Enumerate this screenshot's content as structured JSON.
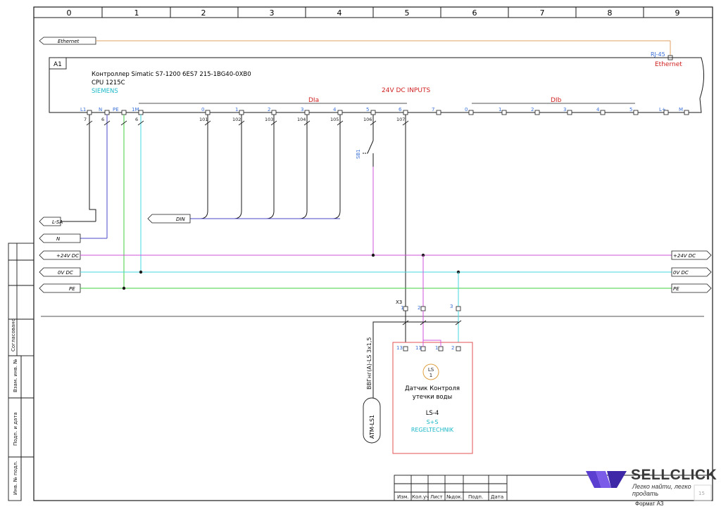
{
  "ruler": [
    "0",
    "1",
    "2",
    "3",
    "4",
    "5",
    "6",
    "7",
    "8",
    "9"
  ],
  "module": {
    "tag": "A1",
    "line1": "Контроллер  Simatic S7-1200  6ES7 215-1BG40-0XB0",
    "line2": "CPU 1215C",
    "vendor": "SIEMENS",
    "inputs_title": "24V DC INPUTS",
    "group_a": "DIa",
    "group_b": "DIb",
    "rj45": "RJ-45",
    "ethernet_port": "Ethernet"
  },
  "pins_top": [
    "L1",
    "N",
    "PE",
    "1M",
    "0",
    "1",
    "2",
    "3",
    "4",
    "5",
    "6",
    "7",
    "0",
    "1",
    "2",
    "3",
    "4",
    "5",
    "L+",
    "M"
  ],
  "wire_numbers": [
    "7",
    "6",
    "6",
    "101",
    "102",
    "103",
    "104",
    "105",
    "106",
    "107"
  ],
  "off_sheet": {
    "ethernet": "Ethernet",
    "l_sa": "L-SA",
    "n": "N",
    "din": "DIN",
    "p24_left": "+24V DC",
    "ov_left": "0V DC",
    "pe_left": "PE",
    "p24_right": "+24V DC",
    "ov_right": "0V DC",
    "pe_right": "PE"
  },
  "switch_label": "SB1",
  "terminal_block": {
    "tag": "X3",
    "pins": [
      "1",
      "2",
      "3"
    ]
  },
  "sensor": {
    "symbol_tag": "LS",
    "symbol_num": "1",
    "name_line1": "Датчик Контроля",
    "name_line2": "утечки воды",
    "model": "LS-4",
    "brand1": "S+S",
    "brand2": "REGELTECHNIK",
    "pins": [
      "13",
      "11",
      "1",
      "2"
    ]
  },
  "cable": {
    "label": "ВВГнг(А)-LS 3х1,5",
    "tag": "ATM-LS1"
  },
  "side_stamp": [
    "Согласовано",
    "Инв. № подл.",
    "Подп. и дата",
    "Взам. инв. №"
  ],
  "title_block": [
    "Изм.",
    "Кол.уч",
    "Лист",
    "№док.",
    "Подп.",
    "Дата"
  ],
  "format_label": "Формат А3",
  "sheet_num": "15",
  "watermark": {
    "title": "SELLCLICK",
    "subtitle": "Легко найти, легко продать"
  },
  "colors": {
    "frame": "#1a1a1a",
    "blue_text": "#3a6fd8",
    "red_text": "#d02020",
    "cyan_text": "#18b8c8",
    "ethernet_wire": "#e0a060",
    "p24_wire": "#d050d8",
    "ov_wire": "#40d8e0",
    "pe_wire": "#40d040",
    "n_wire": "#4848c8",
    "sensor_box": "#e05050",
    "sensor_symbol": "#e0a040",
    "watermark_purple": "#5b3fd0"
  }
}
